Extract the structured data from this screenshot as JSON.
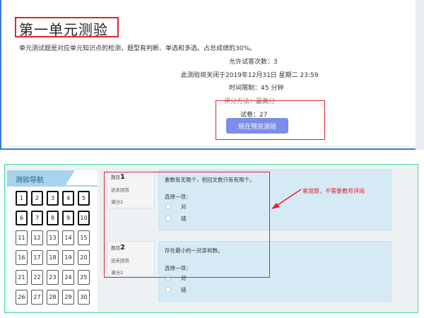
{
  "quiz": {
    "title": "第一单元测验",
    "description": "单元测试题是对应单元知识点的检测，题型有判断、单选和多选。占总成绩的30%。",
    "attempts_allowed": "允许试答次数：3",
    "close_time": "此测验将关闭于2019年12月31日 星期二 23:59",
    "time_limit": "时间限制：45 分钟",
    "grading_method": "评分方法：最高分",
    "papers": "试卷：27",
    "preview_button": "现在预览测验"
  },
  "nav": {
    "title": "测验导航",
    "buttons": [
      "1",
      "2",
      "3",
      "4",
      "5",
      "6",
      "7",
      "8",
      "9",
      "10",
      "11",
      "12",
      "13",
      "14",
      "15",
      "16",
      "17",
      "18",
      "19",
      "20",
      "21",
      "22",
      "23",
      "24",
      "25",
      "26",
      "27",
      "28",
      "29",
      "30"
    ]
  },
  "questions": [
    {
      "label": "题目",
      "number": "1",
      "status": "还未回答",
      "score": "满分2",
      "text": "素数有无限个，但回文数只有有限个。",
      "prompt": "选择一项：",
      "options": [
        "对",
        "错"
      ]
    },
    {
      "label": "题目",
      "number": "2",
      "status": "还未回答",
      "score": "满分2",
      "text": "存在最小的一对亲和数。",
      "prompt": "选择一项：",
      "options": [
        "对",
        "错"
      ]
    }
  ],
  "annotation": "客观题，不需要教师评阅",
  "colors": {
    "accent_red": "#e0242d",
    "button_blue": "#7b8de8",
    "nav_header": "#a7d3ec",
    "question_bg": "#d6eaf6",
    "panel_border_green": "#3ed89b",
    "top_border_blue": "#3a7bd5"
  }
}
